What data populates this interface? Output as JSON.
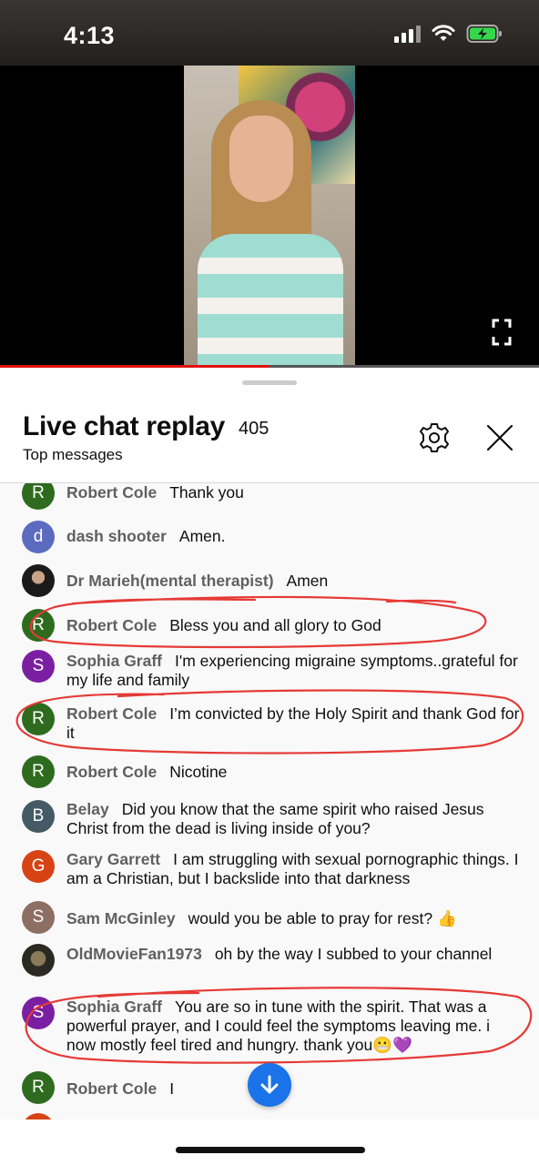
{
  "status_bar": {
    "time": "4:13",
    "signal_icon": "signal-icon",
    "wifi_icon": "wifi-icon",
    "battery_icon": "battery-charging-icon"
  },
  "video": {
    "progress_fraction": 0.5,
    "fullscreen_icon": "fullscreen-icon",
    "progress_color": "#e0120f"
  },
  "chat_header": {
    "title": "Live chat replay",
    "count": "405",
    "subtitle": "Top messages",
    "settings_icon": "gear-icon",
    "close_icon": "close-icon"
  },
  "messages": [
    {
      "author": "Robert Cole",
      "text": "Thank you",
      "avatar_letter": "R",
      "avatar_color": "#2e6b1f"
    },
    {
      "author": "dash shooter",
      "text": "Amen.",
      "avatar_letter": "d",
      "avatar_color": "#5c6bc0"
    },
    {
      "author": "Dr Marieh(mental therapist)",
      "text": "Amen",
      "avatar_letter": "",
      "avatar_color": "#3a3a3a"
    },
    {
      "author": "Robert Cole",
      "text": "Bless you and all glory to God",
      "avatar_letter": "R",
      "avatar_color": "#2e6b1f"
    },
    {
      "author": "Sophia Graff",
      "text": "I'm experiencing migraine symptoms..grateful for my life and family",
      "avatar_letter": "S",
      "avatar_color": "#7b1fa2"
    },
    {
      "author": "Robert Cole",
      "text": "I’m convicted by the Holy Spirit and thank God for it",
      "avatar_letter": "R",
      "avatar_color": "#2e6b1f"
    },
    {
      "author": "Robert Cole",
      "text": "Nicotine",
      "avatar_letter": "R",
      "avatar_color": "#2e6b1f"
    },
    {
      "author": "Belay",
      "text": "Did you know that the same spirit who raised Jesus Christ from the dead is living inside of you?",
      "avatar_letter": "B",
      "avatar_color": "#455a64"
    },
    {
      "author": "Gary Garrett",
      "text": "I am struggling with sexual pornographic things. I am a Christian, but I backslide into that darkness",
      "avatar_letter": "G",
      "avatar_color": "#d84315"
    },
    {
      "author": "Sam McGinley",
      "text": "would you be able to pray for rest? 👍",
      "avatar_letter": "S",
      "avatar_color": "#8d6e63"
    },
    {
      "author": "OldMovieFan1973",
      "text": "oh by the way I subbed to your channel",
      "avatar_letter": "",
      "avatar_color": "#4a4a3a"
    },
    {
      "author": "Sophia Graff",
      "text": "You are so in tune with the spirit. That was a powerful prayer, and I could feel the symptoms leaving me. i now mostly feel tired and hungry. thank you😬💜",
      "avatar_letter": "S",
      "avatar_color": "#7b1fa2"
    },
    {
      "author": "Robert Cole",
      "text": "I",
      "avatar_letter": "R",
      "avatar_color": "#2e6b1f"
    }
  ],
  "scroll_button": {
    "icon": "arrow-down-icon",
    "color": "#1a73e8"
  }
}
